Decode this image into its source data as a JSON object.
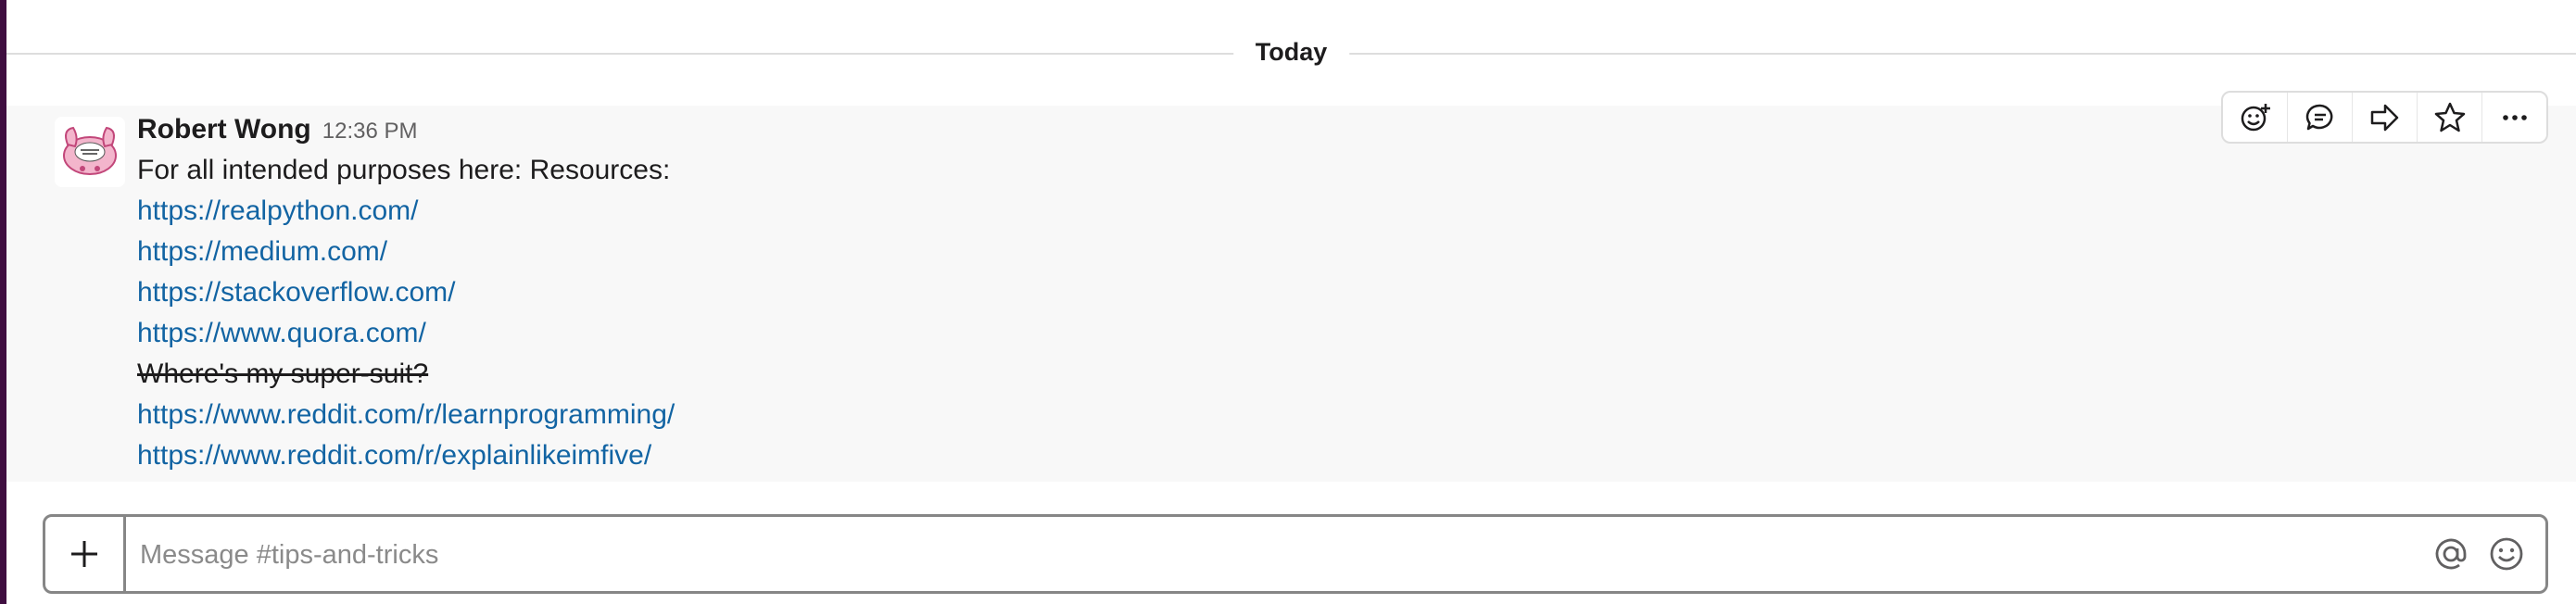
{
  "divider": {
    "label": "Today"
  },
  "message": {
    "author": "Robert Wong",
    "time": "12:36 PM",
    "lines": [
      {
        "text": "For all intended purposes here: Resources:"
      },
      {
        "text": "https://realpython.com/"
      },
      {
        "text": "https://medium.com/"
      },
      {
        "text": "https://stackoverflow.com/"
      },
      {
        "text": "https://www.quora.com/"
      },
      {
        "text": "Where's my super-suit?"
      },
      {
        "text": "https://www.reddit.com/r/learnprogramming/"
      },
      {
        "text": "https://www.reddit.com/r/explainlikeimfive/"
      }
    ]
  },
  "toolbar": {
    "icons": [
      "add-reaction-icon",
      "reply-thread-icon",
      "share-message-icon",
      "star-icon",
      "more-actions-icon"
    ]
  },
  "composer": {
    "placeholder": "Message #tips-and-tricks"
  },
  "colors": {
    "link": "#1264a3",
    "message_bg": "#f8f8f8",
    "sidebar": "#3f0e40"
  }
}
